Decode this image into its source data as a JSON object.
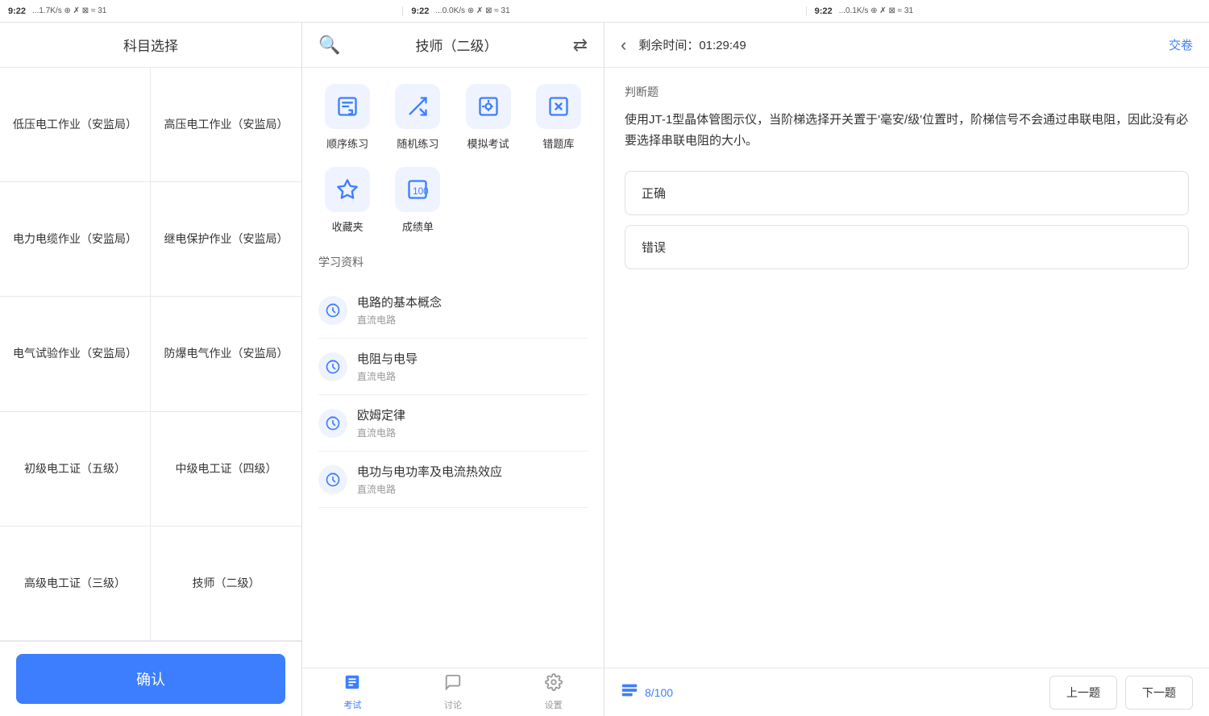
{
  "statusBars": [
    {
      "time": "9:22",
      "signal": "...1.7K/s ⊕ ✗ ⊠ ≈ ⊙ 31"
    },
    {
      "time": "9:22",
      "signal": "...0.0K/s ⊕ ✗ ⊠ ≈ ⊙ 31"
    },
    {
      "time": "9:22",
      "signal": "...0.1K/s ⊕ ✗ ⊠ ≈ ⊙ 31"
    }
  ],
  "panel1": {
    "title": "科目选择",
    "subjects": [
      "低压电工作业（安监局）",
      "高压电工作业（安监局）",
      "电力电缆作业（安监局）",
      "继电保护作业（安监局）",
      "电气试验作业（安监局）",
      "防爆电气作业（安监局）",
      "初级电工证（五级）",
      "中级电工证（四级）",
      "高级电工证（三级）",
      "技师（二级）"
    ],
    "confirmLabel": "确认"
  },
  "panel2": {
    "title": "技师（二级）",
    "searchIcon": "🔍",
    "switchIcon": "⇄",
    "practiceItems": [
      {
        "icon": "📝",
        "label": "顺序练习"
      },
      {
        "icon": "🔀",
        "label": "随机练习"
      },
      {
        "icon": "🕐",
        "label": "模拟考试"
      },
      {
        "icon": "✖",
        "label": "错题库"
      }
    ],
    "bookmarkItems": [
      {
        "icon": "⭐",
        "label": "收藏夹"
      },
      {
        "icon": "💯",
        "label": "成绩单"
      }
    ],
    "sectionTitle": "学习资料",
    "materials": [
      {
        "name": "电路的基本概念",
        "sub": "直流电路"
      },
      {
        "name": "电阻与电导",
        "sub": "直流电路"
      },
      {
        "name": "欧姆定律",
        "sub": "直流电路"
      },
      {
        "name": "电功与电功率及电流热效应",
        "sub": "直流电路"
      }
    ],
    "navItems": [
      {
        "icon": "📋",
        "label": "考试",
        "active": true
      },
      {
        "icon": "💬",
        "label": "讨论",
        "active": false
      },
      {
        "icon": "⚙",
        "label": "设置",
        "active": false
      }
    ]
  },
  "panel3": {
    "backIcon": "‹",
    "timerLabel": "剩余时间：01:29:49",
    "submitLabel": "交卷",
    "questionType": "判断题",
    "questionText": "使用JT-1型晶体管图示仪，当阶梯选择开关置于'毫安/级'位置时，阶梯信号不会通过串联电阻，因此没有必要选择串联电阻的大小。",
    "options": [
      {
        "label": "正确"
      },
      {
        "label": "错误"
      }
    ],
    "answerCardIcon": "≡",
    "answerCardText": "8/100",
    "prevLabel": "上一题",
    "nextLabel": "下一题"
  }
}
